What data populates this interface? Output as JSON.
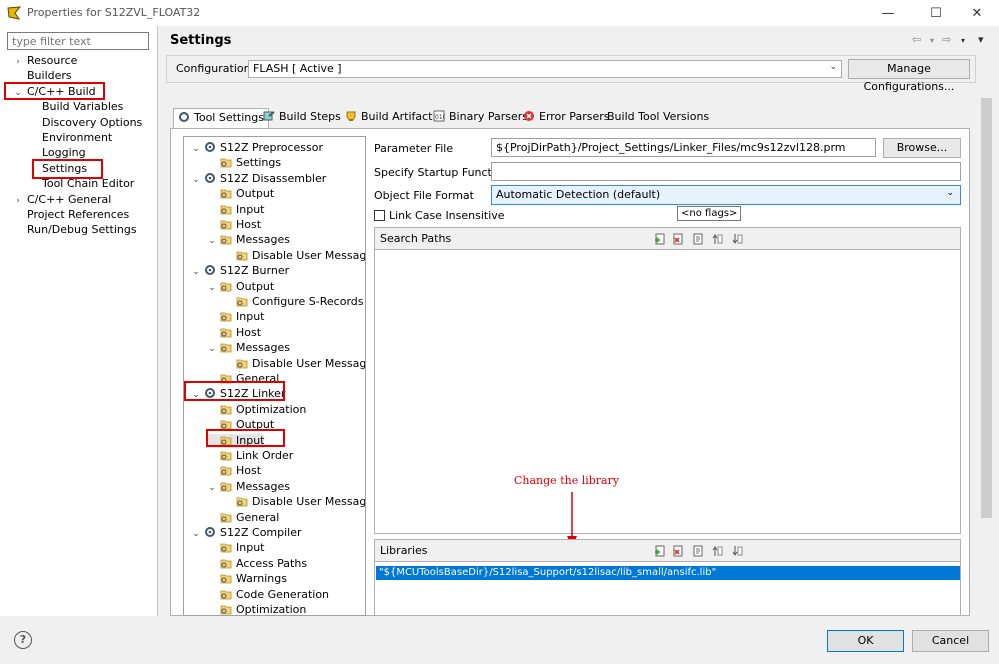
{
  "window": {
    "title": "Properties for S12ZVL_FLOAT32",
    "minimize": "—",
    "maximize": "☐",
    "close": "✕"
  },
  "left": {
    "filter_placeholder": "type filter text",
    "items": [
      {
        "label": "Resource",
        "arrow": "›",
        "indent": 0
      },
      {
        "label": "Builders",
        "arrow": "",
        "indent": 0
      },
      {
        "label": "C/C++ Build",
        "arrow": "⌄",
        "indent": 0
      },
      {
        "label": "Build Variables",
        "arrow": "",
        "indent": 1
      },
      {
        "label": "Discovery Options",
        "arrow": "",
        "indent": 1
      },
      {
        "label": "Environment",
        "arrow": "",
        "indent": 1
      },
      {
        "label": "Logging",
        "arrow": "",
        "indent": 1
      },
      {
        "label": "Settings",
        "arrow": "",
        "indent": 1
      },
      {
        "label": "Tool Chain Editor",
        "arrow": "",
        "indent": 1
      },
      {
        "label": "C/C++ General",
        "arrow": "›",
        "indent": 0
      },
      {
        "label": "Project References",
        "arrow": "",
        "indent": 0
      },
      {
        "label": "Run/Debug Settings",
        "arrow": "",
        "indent": 0
      }
    ]
  },
  "header": {
    "title": "Settings",
    "configuration_label": "Configuration:",
    "configuration_value": "FLASH  [ Active ]",
    "manage_button": "Manage Configurations..."
  },
  "tabs": [
    {
      "label": "Tool Settings",
      "active": true
    },
    {
      "label": "Build Steps",
      "active": false
    },
    {
      "label": "Build Artifact",
      "active": false
    },
    {
      "label": "Binary Parsers",
      "active": false
    },
    {
      "label": "Error Parsers",
      "active": false
    },
    {
      "label": "Build Tool Versions",
      "active": false
    }
  ],
  "tool_tree": [
    {
      "label": "S12Z Preprocessor",
      "level": 0,
      "expanded": true,
      "icon": "tool"
    },
    {
      "label": "Settings",
      "level": 1,
      "icon": "folder"
    },
    {
      "label": "S12Z Disassembler",
      "level": 0,
      "expanded": true,
      "icon": "tool"
    },
    {
      "label": "Output",
      "level": 1,
      "icon": "folder"
    },
    {
      "label": "Input",
      "level": 1,
      "icon": "folder"
    },
    {
      "label": "Host",
      "level": 1,
      "icon": "folder"
    },
    {
      "label": "Messages",
      "level": 1,
      "expanded": true,
      "icon": "folder"
    },
    {
      "label": "Disable User Messages",
      "level": 2,
      "icon": "folder"
    },
    {
      "label": "S12Z Burner",
      "level": 0,
      "expanded": true,
      "icon": "tool"
    },
    {
      "label": "Output",
      "level": 1,
      "expanded": true,
      "icon": "folder"
    },
    {
      "label": "Configure S-Records",
      "level": 2,
      "icon": "folder"
    },
    {
      "label": "Input",
      "level": 1,
      "icon": "folder"
    },
    {
      "label": "Host",
      "level": 1,
      "icon": "folder"
    },
    {
      "label": "Messages",
      "level": 1,
      "expanded": true,
      "icon": "folder"
    },
    {
      "label": "Disable User Messages",
      "level": 2,
      "icon": "folder"
    },
    {
      "label": "General",
      "level": 1,
      "icon": "folder"
    },
    {
      "label": "S12Z Linker",
      "level": 0,
      "expanded": true,
      "icon": "tool"
    },
    {
      "label": "Optimization",
      "level": 1,
      "icon": "folder"
    },
    {
      "label": "Output",
      "level": 1,
      "icon": "folder"
    },
    {
      "label": "Input",
      "level": 1,
      "icon": "folder",
      "selected": true
    },
    {
      "label": "Link Order",
      "level": 1,
      "icon": "folder"
    },
    {
      "label": "Host",
      "level": 1,
      "icon": "folder"
    },
    {
      "label": "Messages",
      "level": 1,
      "expanded": true,
      "icon": "folder"
    },
    {
      "label": "Disable User Messages",
      "level": 2,
      "icon": "folder"
    },
    {
      "label": "General",
      "level": 1,
      "icon": "folder"
    },
    {
      "label": "S12Z Compiler",
      "level": 0,
      "expanded": true,
      "icon": "tool"
    },
    {
      "label": "Input",
      "level": 1,
      "icon": "folder"
    },
    {
      "label": "Access Paths",
      "level": 1,
      "icon": "folder"
    },
    {
      "label": "Warnings",
      "level": 1,
      "icon": "folder"
    },
    {
      "label": "Code Generation",
      "level": 1,
      "icon": "folder"
    },
    {
      "label": "Optimization",
      "level": 1,
      "icon": "folder"
    }
  ],
  "form": {
    "param_file_label": "Parameter File",
    "param_file_value": "${ProjDirPath}/Project_Settings/Linker_Files/mc9s12zvl128.prm",
    "browse_button": "Browse...",
    "startup_label": "Specify Startup Function",
    "startup_value": "",
    "objfmt_label": "Object File Format",
    "objfmt_value": "Automatic Detection (default)",
    "tooltip": "<no flags>",
    "link_case_label": "Link Case Insensitive",
    "search_paths_label": "Search Paths",
    "libraries_label": "Libraries",
    "library_item": "\"${MCUToolsBaseDir}/S12lisa_Support/s12lisac/lib_small/ansifc.lib\""
  },
  "annotation": "Change the library",
  "footer": {
    "help": "?",
    "ok": "OK",
    "cancel": "Cancel"
  },
  "colors": {
    "highlight_red": "#e00000",
    "selection_blue": "#0078d7"
  }
}
